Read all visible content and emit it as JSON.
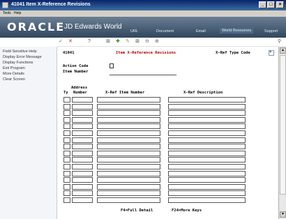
{
  "window": {
    "title": "41041   Item X-Reference Revisions"
  },
  "menu": {
    "items": [
      "Tools",
      "Help"
    ]
  },
  "banner": {
    "oracle": "ORACLE",
    "product": "JD Edwards World",
    "links": [
      "URL",
      "Document",
      "Email",
      "World Resources",
      "Support"
    ]
  },
  "sidebar": {
    "items": [
      "Field Sensitive Help",
      "Display Error Message",
      "Display Functions",
      "Exit Program",
      "More Details",
      "Clear Screen"
    ]
  },
  "form": {
    "program_id": "41041",
    "title": "Item X-Reference Revisions",
    "xref_type_label": "X-Ref Type Code",
    "xref_type_value": "*",
    "action_code_label": "Action Code",
    "item_number_label": "Item Number",
    "grid_header_address": "Address",
    "grid_headers": [
      "Ty",
      "Number",
      "X-Ref Item Number",
      "X-Ref Description"
    ],
    "function_keys": [
      "F4=Full Detail",
      "F24=More Keys"
    ]
  }
}
